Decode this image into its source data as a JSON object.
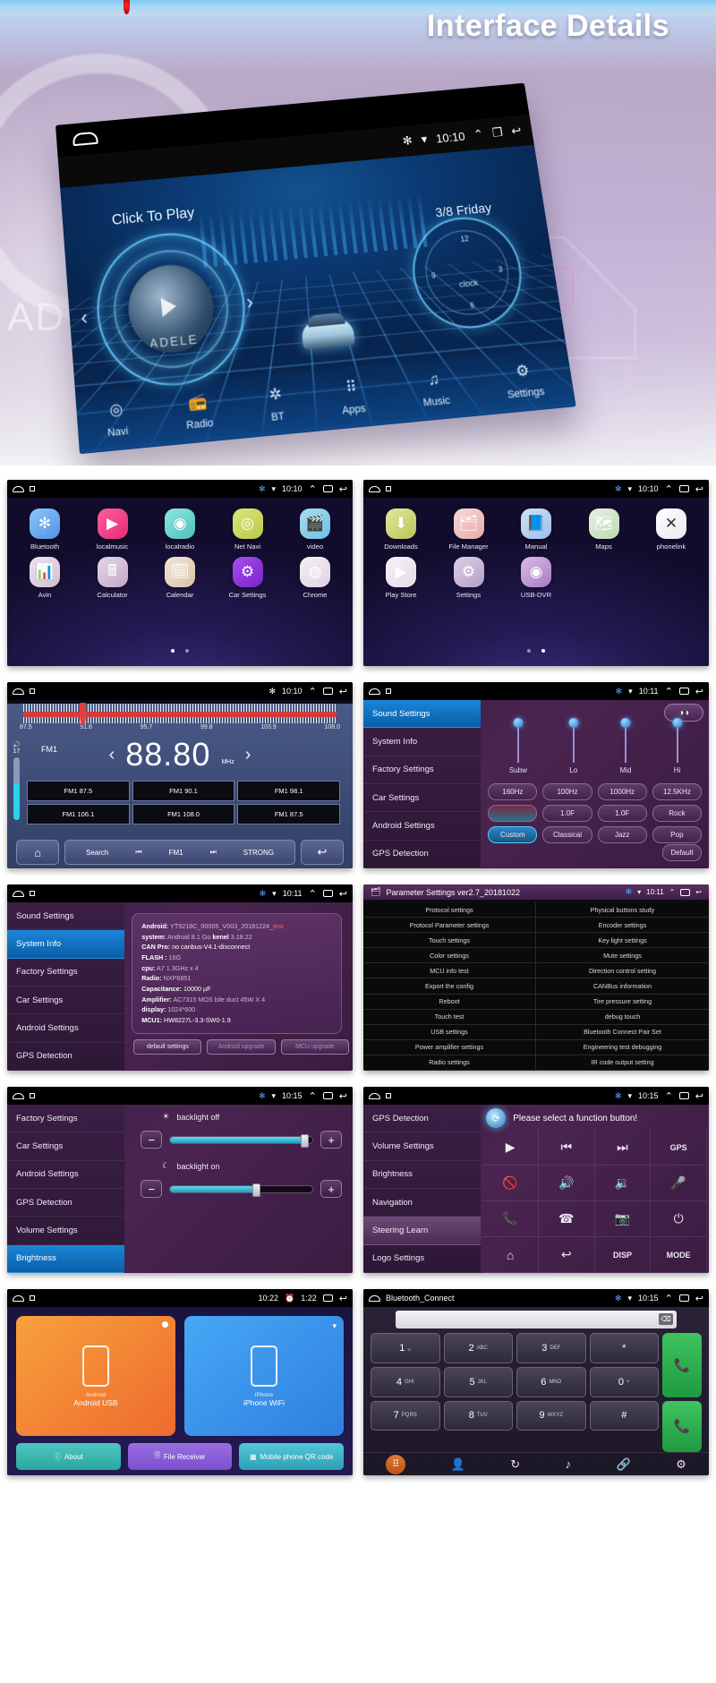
{
  "hero": {
    "title": "Interface Details",
    "ad_text": "AD",
    "device": {
      "status": {
        "bluetooth": "bt-icon",
        "wifi": "wifi-icon",
        "time": "10:10",
        "up": "expand-up-icon",
        "recent": "recents-icon",
        "back": "back-icon"
      },
      "click_to_play": "Click To Play",
      "date": "3/8 Friday",
      "album_artist": "ADELE",
      "clock_word": "clock",
      "clock_marks": [
        "12",
        "3",
        "6",
        "9"
      ],
      "nav": [
        {
          "label": "Navi",
          "icon": "location-pin-icon"
        },
        {
          "label": "Radio",
          "icon": "radio-icon"
        },
        {
          "label": "BT",
          "icon": "bluetooth-icon"
        },
        {
          "label": "Apps",
          "icon": "apps-grid-icon"
        },
        {
          "label": "Music",
          "icon": "music-note-icon"
        },
        {
          "label": "Settings",
          "icon": "gear-icon"
        }
      ]
    }
  },
  "shots": {
    "apps_page1": {
      "status_time": "10:10",
      "apps": [
        {
          "label": "Bluetooth",
          "icon": "bluetooth-icon",
          "color": "#6ab3f0"
        },
        {
          "label": "localmusic",
          "icon": "music-play-icon",
          "color": "#f0407f"
        },
        {
          "label": "localradio",
          "icon": "radio-icon",
          "color": "#6fd8d2"
        },
        {
          "label": "Net Navi",
          "icon": "location-pin-icon",
          "color": "#cdd95e"
        },
        {
          "label": "video",
          "icon": "clapboard-icon",
          "color": "#8fd4ee"
        },
        {
          "label": "Avin",
          "icon": "avin-icon",
          "color": "#e3cfe0"
        },
        {
          "label": "Calculator",
          "icon": "calculator-icon",
          "color": "#d9c3dd"
        },
        {
          "label": "Calendar",
          "icon": "calendar-icon",
          "color": "#e4d6c9"
        },
        {
          "label": "Car Settings",
          "icon": "gear-icon",
          "color": "#8b2fd6"
        },
        {
          "label": "Chrome",
          "icon": "chrome-icon",
          "color": "#efe6ef"
        }
      ],
      "page_dots": 2,
      "active_dot": 0
    },
    "apps_page2": {
      "status_time": "10:10",
      "apps": [
        {
          "label": "Downloads",
          "icon": "download-icon",
          "color": "#c9cf62"
        },
        {
          "label": "File Manager",
          "icon": "file-manager-icon",
          "color": "#efb6b6"
        },
        {
          "label": "Manual",
          "icon": "book-icon",
          "color": "#3d8ce8"
        },
        {
          "label": "Maps",
          "icon": "maps-icon",
          "color": "#7ec86f"
        },
        {
          "label": "phonelink",
          "icon": "phonelink-icon",
          "color": "#ffffff"
        },
        {
          "label": "Play Store",
          "icon": "play-store-icon",
          "color": "#f0eef4"
        },
        {
          "label": "Settings",
          "icon": "gear-icon",
          "color": "#c9b8d8"
        },
        {
          "label": "USB-DVR",
          "icon": "camera-icon",
          "color": "#c49ad4"
        }
      ],
      "page_dots": 2,
      "active_dot": 1
    },
    "radio": {
      "status_time": "10:10",
      "band": "FM1",
      "frequency": "88.80",
      "unit": "MHz",
      "volume": "17",
      "scale_ticks": [
        "87.5",
        "91.6",
        "95.7",
        "99.8",
        "103.9",
        "108.0"
      ],
      "presets": [
        "FM1 87.5",
        "FM1 90.1",
        "FM1 98.1",
        "FM1 106.1",
        "FM1 108.0",
        "FM1 87.5"
      ],
      "bottom": {
        "home": "home-icon",
        "search": "Search",
        "prev": "prev-icon",
        "band": "FM1",
        "next": "next-icon",
        "strong": "STRONG",
        "back": "back-icon"
      }
    },
    "sound_settings": {
      "status_time": "10:11",
      "nav": [
        "Sound Settings",
        "System Info",
        "Factory Settings",
        "Car Settings",
        "Android Settings",
        "GPS Detection"
      ],
      "active_nav": "Sound Settings",
      "sliders": [
        "Subw",
        "Lo",
        "Mid",
        "Hi"
      ],
      "freq_row": [
        "160Hz",
        "100Hz",
        "1000Hz",
        "12.5KHz"
      ],
      "q_row": [
        "",
        "1.0F",
        "1.0F",
        "Rock"
      ],
      "preset_row": [
        "Custom",
        "Classical",
        "Jazz",
        "Pop"
      ],
      "default_button": "Default",
      "fade_button": "balance-icon"
    },
    "system_info": {
      "status_time": "10:11",
      "nav": [
        "Sound Settings",
        "System Info",
        "Factory Settings",
        "Car Settings",
        "Android Settings",
        "GPS Detection"
      ],
      "active_nav": "System Info",
      "rows": [
        {
          "key": "Android:",
          "value": "YT9218C_00005_V003_20181224_",
          "extra": "test"
        },
        {
          "key": "system:",
          "value": "Android 8.1 Go",
          "key2": "kenel",
          "value2": "3.18.22"
        },
        {
          "key": "CAN Pro:",
          "value": "no canbus-V4.1-disconnect"
        },
        {
          "key": "FLASH :",
          "value": "16G"
        },
        {
          "key": "cpu:",
          "value": "A7 1.3GHz x 4"
        },
        {
          "key": "Radio:",
          "value": "NXP6851"
        },
        {
          "key": "Capacitance:",
          "value": "10000 µF"
        },
        {
          "key": "Amplifier:",
          "value": "AC7315 MOS bile duct 45W X 4"
        },
        {
          "key": "display:",
          "value": "1024*600"
        },
        {
          "key": "MCU1:",
          "value": "HW8227L-3.3-SW0-1.9"
        }
      ],
      "buttons": [
        "default settings",
        "Android upgrade",
        "MCU upgrade"
      ]
    },
    "parameter_settings": {
      "title": "Parameter Settings ver2.7_20181022",
      "status_time": "10:11",
      "rows": [
        [
          "Protocol settings",
          "Physical buttons study"
        ],
        [
          "Protocol Parameter settings",
          "Encoder settings"
        ],
        [
          "Touch settings",
          "Key light settings"
        ],
        [
          "Color settings",
          "Mute settings"
        ],
        [
          "MCU info test",
          "Direction control setting"
        ],
        [
          "Export the config",
          "CANBus information"
        ],
        [
          "Reboot",
          "Tire pressure setting"
        ],
        [
          "Touch test",
          "debug touch"
        ],
        [
          "USB settings",
          "Bluetooth Connect Pair Set"
        ],
        [
          "Power amplifier settings",
          "Engineering test debugging"
        ],
        [
          "Radio settings",
          "IR code output setting"
        ]
      ]
    },
    "brightness": {
      "status_time": "10:15",
      "nav": [
        "Factory Settings",
        "Car Settings",
        "Android Settings",
        "GPS Detection",
        "Volume Settings",
        "Brightness"
      ],
      "active_nav": "Brightness",
      "controls": [
        {
          "icon": "sun-icon",
          "label": "backlight off",
          "value": 96
        },
        {
          "icon": "moon-icon",
          "label": "backlight on",
          "value": 62
        }
      ],
      "minus": "−",
      "plus": "+"
    },
    "steering_learn": {
      "status_time": "10:15",
      "nav": [
        "GPS Detection",
        "Volume Settings",
        "Brightness",
        "Navigation",
        "Steering Learn",
        "Logo Settings"
      ],
      "active_nav": "Steering Learn",
      "prompt": "Please select a function button!",
      "buttons": [
        {
          "icon": "play-icon",
          "label": ""
        },
        {
          "icon": "prev-track-icon",
          "label": ""
        },
        {
          "icon": "next-track-icon",
          "label": ""
        },
        {
          "icon": "",
          "label": "GPS"
        },
        {
          "icon": "mute-icon",
          "label": ""
        },
        {
          "icon": "volume-up-icon",
          "label": ""
        },
        {
          "icon": "volume-down-icon",
          "label": ""
        },
        {
          "icon": "mic-icon",
          "label": ""
        },
        {
          "icon": "call-icon",
          "label": ""
        },
        {
          "icon": "hangup-icon",
          "label": ""
        },
        {
          "icon": "camera-icon",
          "label": ""
        },
        {
          "icon": "power-icon",
          "label": ""
        },
        {
          "icon": "home-icon",
          "label": ""
        },
        {
          "icon": "back-icon",
          "label": ""
        },
        {
          "icon": "",
          "label": "DISP"
        },
        {
          "icon": "",
          "label": "MODE"
        }
      ]
    },
    "phone_link": {
      "status_time": "10:22",
      "status_extra": "1:22",
      "cards": [
        {
          "title": "Android USB",
          "sub": "Android",
          "badge": "dot-badge"
        },
        {
          "title": "iPhone WiFi",
          "sub": "iPhone",
          "badge": "wifi-icon"
        }
      ],
      "buttons": [
        {
          "label": "About",
          "icon": "info-icon"
        },
        {
          "label": "File Receiver",
          "icon": "file-icon"
        },
        {
          "label": "Mobile phone QR code",
          "icon": "qr-icon"
        }
      ]
    },
    "bluetooth_connect": {
      "title": "Bluetooth_Connect",
      "status_time": "10:15",
      "input_value": "",
      "keys": [
        {
          "num": "1",
          "sub": "␣"
        },
        {
          "num": "2",
          "sub": "ABC"
        },
        {
          "num": "3",
          "sub": "DEF"
        },
        {
          "num": "*",
          "sub": ""
        },
        {
          "num": "4",
          "sub": "GHI"
        },
        {
          "num": "5",
          "sub": "JKL"
        },
        {
          "num": "6",
          "sub": "MNO"
        },
        {
          "num": "0",
          "sub": "+"
        },
        {
          "num": "7",
          "sub": "PQRS"
        },
        {
          "num": "8",
          "sub": "TUV"
        },
        {
          "num": "9",
          "sub": "WXYZ"
        },
        {
          "num": "#",
          "sub": ""
        }
      ],
      "call_button": "call-icon",
      "hangup_button": "hangup-icon",
      "tabs": [
        "dialpad-icon",
        "contacts-icon",
        "call-log-icon",
        "music-icon",
        "link-icon",
        "settings-icon"
      ]
    }
  }
}
